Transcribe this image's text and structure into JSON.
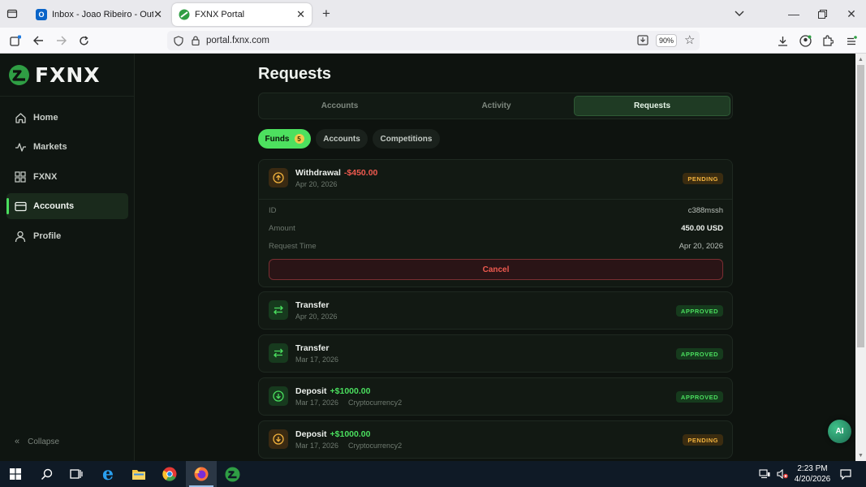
{
  "browser": {
    "tabs": [
      {
        "label": "Inbox - Joao Ribeiro - Outlook",
        "icon": "outlook-icon"
      },
      {
        "label": "FXNX Portal",
        "icon": "fxnx-icon"
      }
    ],
    "url": "portal.fxnx.com",
    "zoom": "90%"
  },
  "sidebar": {
    "logo_text": "FXNX",
    "items": [
      {
        "label": "Home",
        "icon": "home-icon"
      },
      {
        "label": "Markets",
        "icon": "markets-icon"
      },
      {
        "label": "FXNX",
        "icon": "grid-icon"
      },
      {
        "label": "Accounts",
        "icon": "wallet-icon"
      },
      {
        "label": "Profile",
        "icon": "user-icon"
      }
    ],
    "collapse_label": "Collapse"
  },
  "page": {
    "title": "Requests",
    "tabs": [
      "Accounts",
      "Activity",
      "Requests"
    ],
    "active_tab": "Requests",
    "filters": [
      {
        "label": "Funds",
        "count": "5"
      },
      {
        "label": "Accounts"
      },
      {
        "label": "Competitions"
      }
    ]
  },
  "requests": [
    {
      "type": "Withdrawal",
      "amount": "-$450.00",
      "date": "Apr 20, 2026",
      "status": "PENDING",
      "details": {
        "id_label": "ID",
        "id_value": "c388mssh",
        "amount_label": "Amount",
        "amount_value": "450.00 USD",
        "time_label": "Request Time",
        "time_value": "Apr 20, 2026"
      },
      "cancel_label": "Cancel"
    },
    {
      "type": "Transfer",
      "amount": "",
      "date": "Apr 20, 2026",
      "method": "",
      "status": "APPROVED"
    },
    {
      "type": "Transfer",
      "amount": "",
      "date": "Mar 17, 2026",
      "method": "",
      "status": "APPROVED"
    },
    {
      "type": "Deposit",
      "amount": "+$1000.00",
      "date": "Mar 17, 2026",
      "method": "Cryptocurrency2",
      "status": "APPROVED"
    },
    {
      "type": "Deposit",
      "amount": "+$1000.00",
      "date": "Mar 17, 2026",
      "method": "Cryptocurrency2",
      "status": "PENDING"
    }
  ],
  "ai_button": "AI",
  "taskbar": {
    "time": "2:23 PM",
    "date": "4/20/2026"
  },
  "colors": {
    "accent": "#4ade5e",
    "pending": "#f2b33d",
    "negative": "#ef5a4f",
    "background": "#0e130f"
  }
}
